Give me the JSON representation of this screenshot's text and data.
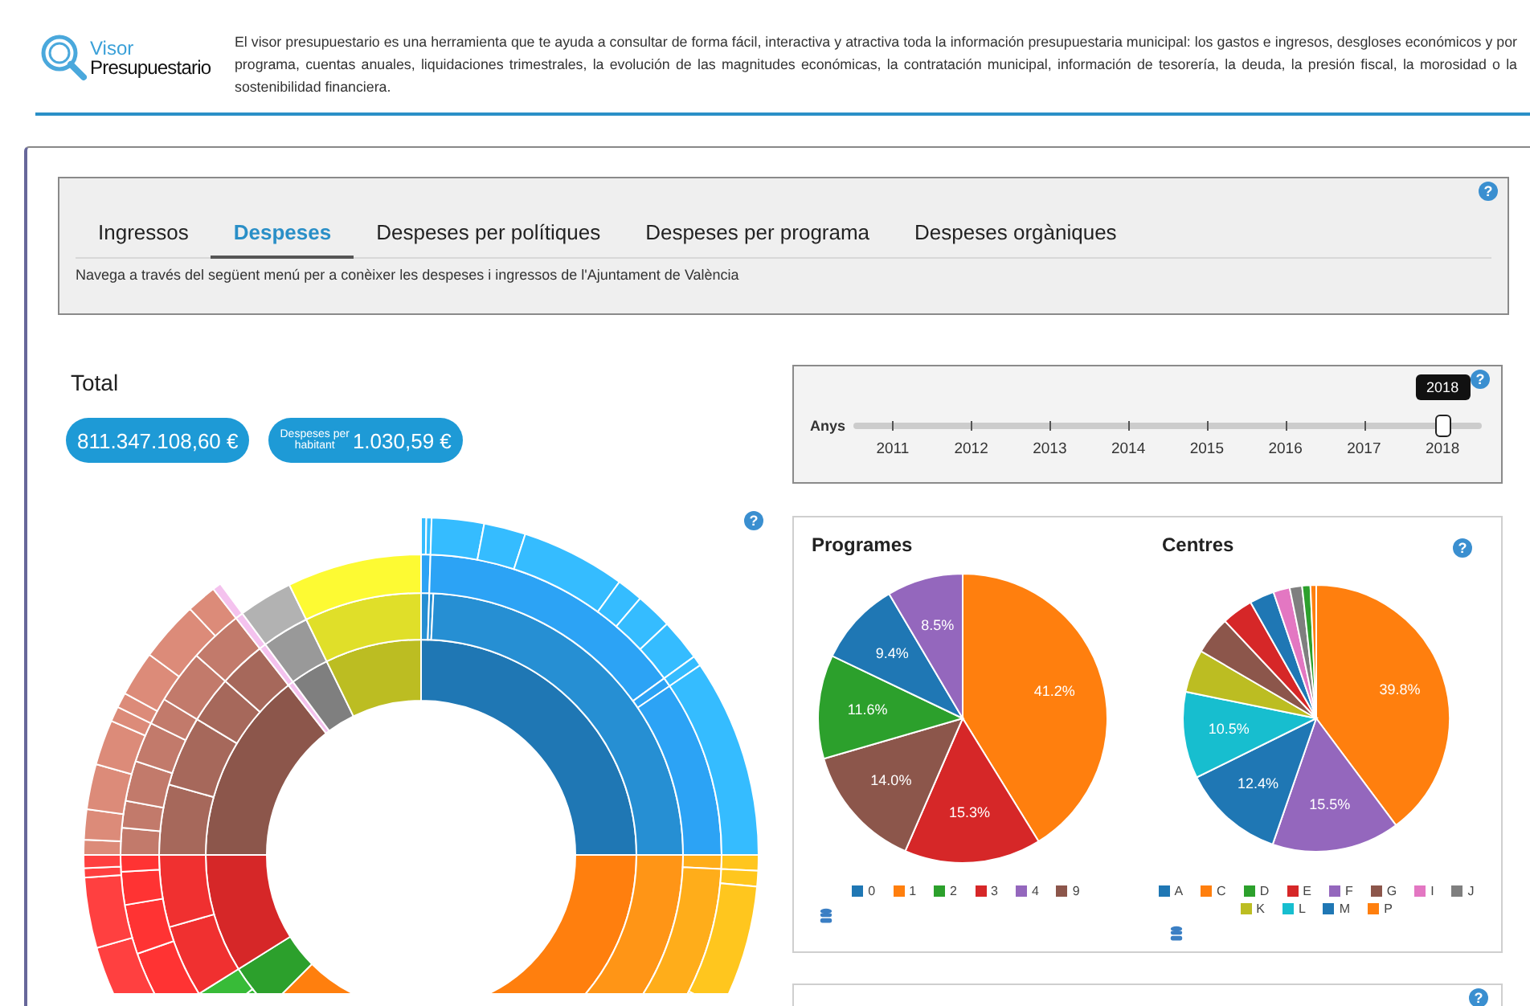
{
  "header": {
    "logo_top": "Visor",
    "logo_bottom": "Presupuestario",
    "description": "El visor presupuestario es una herramienta que te ayuda a consultar de forma fácil, interactiva y atractiva toda la información presupuestaria municipal: los gastos e ingresos, desgloses económicos y por programa, cuentas anuales, liquidaciones trimestrales, la evolución de las magnitudes económicas, la contratación municipal, información de tesorería, la deuda, la presión fiscal, la morosidad o la sostenibilidad financiera."
  },
  "nav": {
    "help": "?",
    "tabs": [
      {
        "label": "Ingressos",
        "selected": false
      },
      {
        "label": "Despeses",
        "selected": true
      },
      {
        "label": "Despeses per polítiques",
        "selected": false
      },
      {
        "label": "Despeses per programa",
        "selected": false
      },
      {
        "label": "Despeses orgàniques",
        "selected": false
      }
    ],
    "hint": "Navega a través del següent menú per a conèixer les despeses i ingressos de l'Ajuntament de València"
  },
  "total": {
    "title": "Total",
    "amount": "811.347.108,60 €",
    "per_label_1": "Despeses per",
    "per_label_2": "habitant",
    "per_amount": "1.030,59 €"
  },
  "sunburst": {
    "help": "?"
  },
  "slider": {
    "help": "?",
    "label": "Anys",
    "years": [
      "2011",
      "2012",
      "2013",
      "2014",
      "2015",
      "2016",
      "2017",
      "2018"
    ],
    "level": 1,
    "tooltip": "2018"
  },
  "pies": {
    "help": "?",
    "charts": [
      {
        "chart_data": {
          "type": "pie",
          "title": "Programes",
          "categories": [
            "0",
            "1",
            "2",
            "3",
            "4",
            "9"
          ],
          "values": [
            9.4,
            41.2,
            11.6,
            15.3,
            8.5,
            14.0
          ],
          "colors": [
            "#1f77b4",
            "#ff7f0e",
            "#2ca02c",
            "#d62728",
            "#9467bd",
            "#8c564b"
          ],
          "value_labels": [
            "9.4%",
            "41.2%",
            "11.6%",
            "15.3%",
            "8.5%",
            "14.0%"
          ]
        }
      },
      {
        "chart_data": {
          "type": "pie",
          "title": "Centres",
          "categories": [
            "A",
            "C",
            "D",
            "E",
            "F",
            "G",
            "I",
            "J",
            "K",
            "L",
            "M",
            "P"
          ],
          "values": [
            12.4,
            39.8,
            1.0,
            3.8,
            15.5,
            4.6,
            2.0,
            1.5,
            5.2,
            10.5,
            3.0,
            0.7
          ],
          "colors": [
            "#1f77b4",
            "#ff7f0e",
            "#2ca02c",
            "#d62728",
            "#9467bd",
            "#8c564b",
            "#e377c2",
            "#7f7f7f",
            "#bcbd22",
            "#17becf",
            "#1f77b4",
            "#ff7f0e"
          ],
          "value_labels": [
            "12.4%",
            "39.8%",
            null,
            null,
            "15.5%",
            null,
            null,
            null,
            null,
            "10.5%",
            null,
            null
          ]
        }
      }
    ]
  },
  "next_panel": {
    "help": "?"
  }
}
